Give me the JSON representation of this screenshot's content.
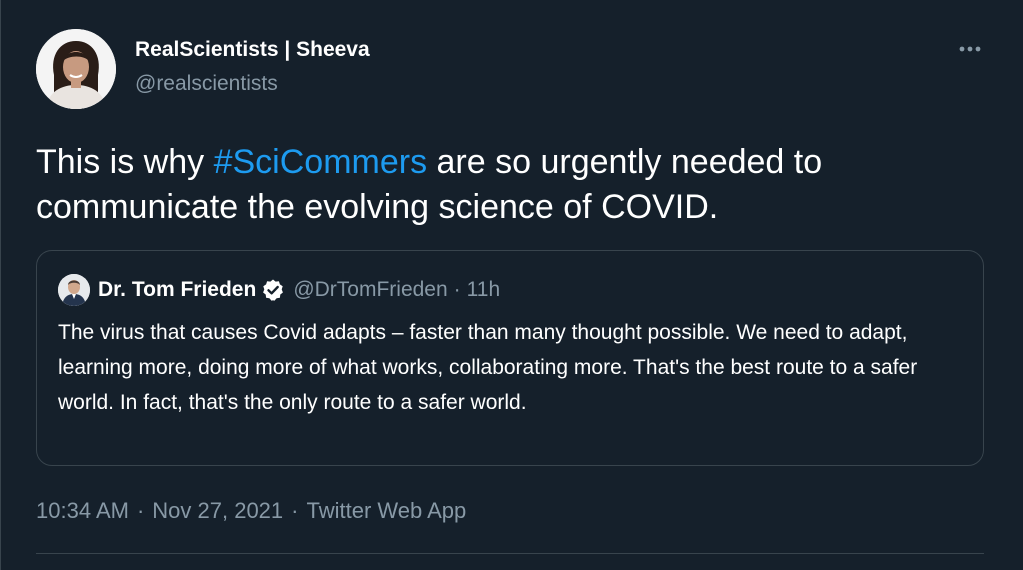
{
  "author": {
    "display_name": "RealScientists | Sheeva",
    "handle": "@realscientists"
  },
  "tweet": {
    "text_before": "This is why ",
    "hashtag": "#SciCommers",
    "text_after": " are so urgently needed to communicate the evolving science of COVID."
  },
  "quoted_tweet": {
    "display_name": "Dr. Tom Frieden",
    "verified": true,
    "handle": "@DrTomFrieden",
    "separator": "·",
    "time": "11h",
    "text": "The virus that causes Covid adapts – faster than many thought possible. We need to adapt, learning more, doing more of what works, collaborating more. That's the best route to a safer world. In fact, that's the only route to a safer world."
  },
  "meta": {
    "time": "10:34 AM",
    "separator": "·",
    "date": "Nov 27, 2021",
    "source": "Twitter Web App"
  },
  "icons": {
    "more": "more-horizontal-icon",
    "verified": "verified-badge-icon"
  },
  "colors": {
    "background": "#15202b",
    "text_primary": "#ffffff",
    "text_secondary": "#8899a6",
    "accent": "#1d9bf0",
    "border": "#38444d"
  }
}
